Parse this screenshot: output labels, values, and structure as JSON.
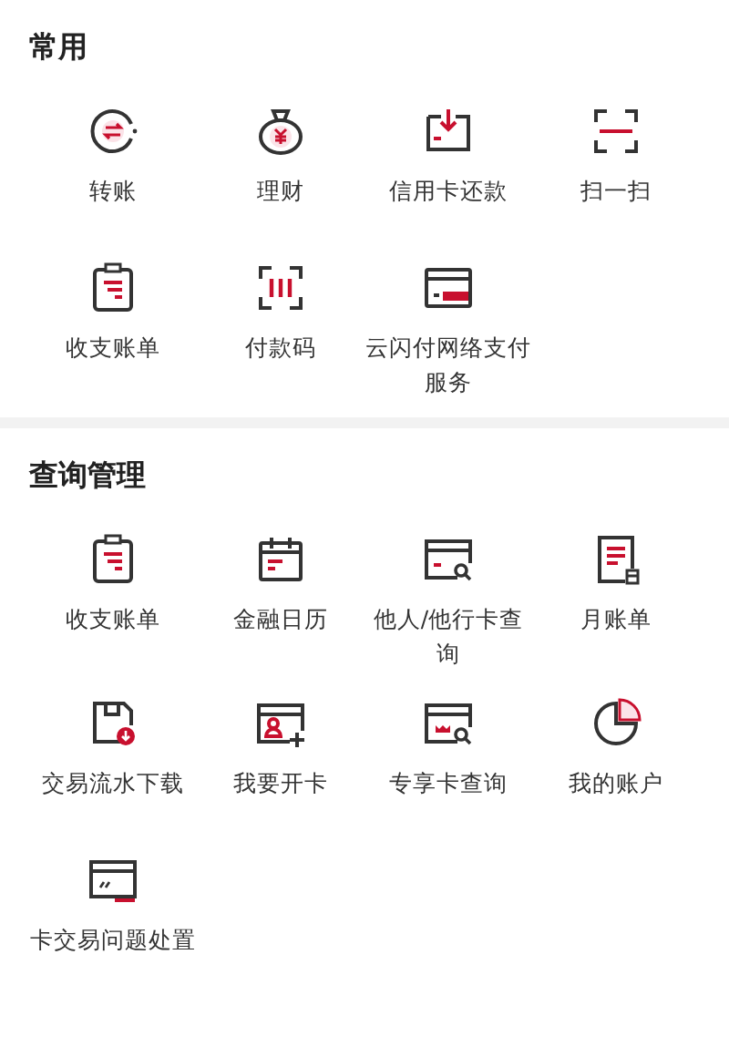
{
  "sections": [
    {
      "title": "常用",
      "items": [
        {
          "label": "转账",
          "kind": "transfer"
        },
        {
          "label": "理财",
          "kind": "wealth"
        },
        {
          "label": "信用卡还款",
          "kind": "repay"
        },
        {
          "label": "扫一扫",
          "kind": "scan"
        },
        {
          "label": "收支账单",
          "kind": "bill"
        },
        {
          "label": "付款码",
          "kind": "paycode"
        },
        {
          "label": "云闪付网络支付服务",
          "kind": "cloudpay"
        }
      ]
    },
    {
      "title": "查询管理",
      "items": [
        {
          "label": "收支账单",
          "kind": "bill"
        },
        {
          "label": "金融日历",
          "kind": "calendar"
        },
        {
          "label": "他人/他行卡查询",
          "kind": "cardsearch"
        },
        {
          "label": "月账单",
          "kind": "monthly"
        },
        {
          "label": "交易流水下载",
          "kind": "download"
        },
        {
          "label": "我要开卡",
          "kind": "opencard"
        },
        {
          "label": "专享卡查询",
          "kind": "vipcard"
        },
        {
          "label": "我的账户",
          "kind": "account"
        },
        {
          "label": "卡交易问题处置",
          "kind": "cardissue"
        }
      ]
    }
  ]
}
